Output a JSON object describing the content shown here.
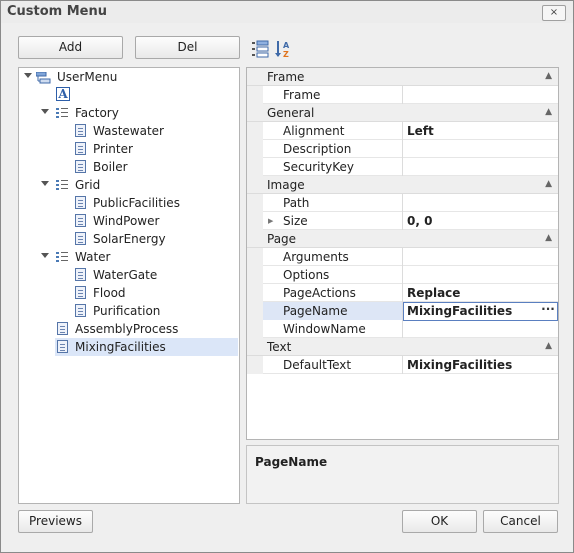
{
  "window": {
    "title": "Custom Menu",
    "close_label": "×"
  },
  "tree_buttons": {
    "add": "Add",
    "del": "Del"
  },
  "tree": {
    "root": "UserMenu",
    "text_item_icon": "A",
    "groups": [
      {
        "label": "Factory",
        "children": [
          "Wastewater",
          "Printer",
          "Boiler"
        ]
      },
      {
        "label": "Grid",
        "children": [
          "PublicFacilities",
          "WindPower",
          "SolarEnergy"
        ]
      },
      {
        "label": "Water",
        "children": [
          "WaterGate",
          "Flood",
          "Purification"
        ]
      }
    ],
    "items": [
      "AssemblyProcess",
      "MixingFacilities"
    ],
    "selected": "MixingFacilities"
  },
  "toolbar": {
    "categorized_icon": "categorized-sort-icon",
    "alphabetical_icon": "alphabetical-sort-icon"
  },
  "properties": {
    "categories": [
      {
        "name": "Frame",
        "rows": [
          {
            "name": "Frame",
            "value": ""
          }
        ]
      },
      {
        "name": "General",
        "rows": [
          {
            "name": "Alignment",
            "value": "Left"
          },
          {
            "name": "Description",
            "value": ""
          },
          {
            "name": "SecurityKey",
            "value": ""
          }
        ]
      },
      {
        "name": "Image",
        "rows": [
          {
            "name": "Path",
            "value": ""
          },
          {
            "name": "Size",
            "value": "0, 0"
          }
        ]
      },
      {
        "name": "Page",
        "rows": [
          {
            "name": "Arguments",
            "value": ""
          },
          {
            "name": "Options",
            "value": ""
          },
          {
            "name": "PageActions",
            "value": "Replace"
          },
          {
            "name": "PageName",
            "value": "MixingFacilities"
          },
          {
            "name": "WindowName",
            "value": ""
          }
        ]
      },
      {
        "name": "Text",
        "rows": [
          {
            "name": "DefaultText",
            "value": "MixingFacilities"
          }
        ]
      }
    ],
    "ellipsis_label": "···"
  },
  "description": {
    "title": "PageName"
  },
  "footer": {
    "previews": "Previews",
    "ok": "OK",
    "cancel": "Cancel"
  },
  "colors": {
    "selection": "#dbe6f8",
    "editor_border": "#5a7fc0",
    "sort_az_accent": "#e0731c"
  }
}
